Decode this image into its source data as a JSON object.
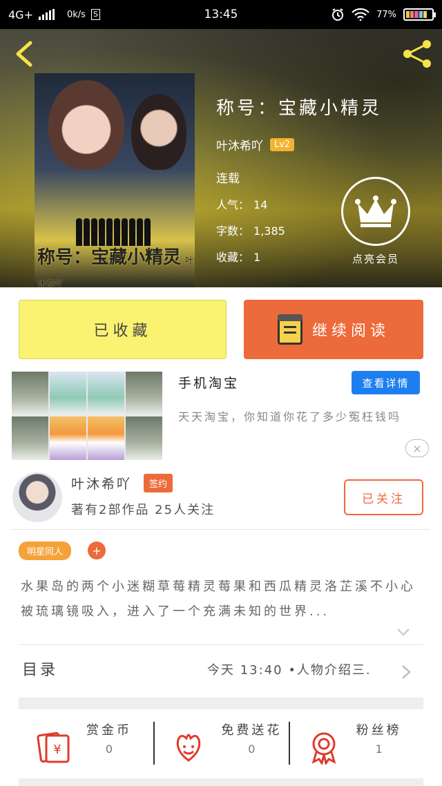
{
  "status_bar": {
    "network": "4G+",
    "speed": "0k/s",
    "s_badge": "S",
    "time": "13:45",
    "battery": "77%"
  },
  "header": {
    "book_title": "称号：宝藏小精灵",
    "author": "叶沐希吖",
    "level": "Lv2",
    "status": "连载",
    "popularity_label": "人气：",
    "popularity_value": "14",
    "words_label": "字数：",
    "words_value": "1,385",
    "collect_label": "收藏：",
    "collect_value": "1",
    "vip_label": "点亮会员",
    "cover_title": "称号：宝藏小精灵",
    "cover_author": "叶沐希吖"
  },
  "actions": {
    "collected": "已收藏",
    "continue_read": "继续阅读"
  },
  "ad": {
    "title": "手机淘宝",
    "detail_button": "查看详情",
    "desc": "天天淘宝，你知道你花了多少冤枉钱吗",
    "close": "×"
  },
  "author_card": {
    "name": "叶沐希吖",
    "signed": "签约",
    "meta": "著有2部作品 25人关注",
    "follow": "已关注"
  },
  "tags": {
    "tag1": "明星同人",
    "add": "+"
  },
  "synopsis": "水果岛的两个小迷糊草莓精灵莓果和西瓜精灵洛芷溪不小心被琉璃镜吸入，进入了一个充满未知的世界...",
  "toc": {
    "label": "目录",
    "latest": "今天 13:40 •人物介绍三."
  },
  "bottom": [
    {
      "label": "赏金币",
      "value": "0",
      "icon": "coin-envelope-icon"
    },
    {
      "label": "免费送花",
      "value": "0",
      "icon": "flower-icon"
    },
    {
      "label": "粉丝榜",
      "value": "1",
      "icon": "medal-icon"
    }
  ],
  "colors": {
    "accent": "#ed6a3a",
    "yellow": "#faf371",
    "blue": "#1d7ef0",
    "tag": "#f5a23a"
  }
}
